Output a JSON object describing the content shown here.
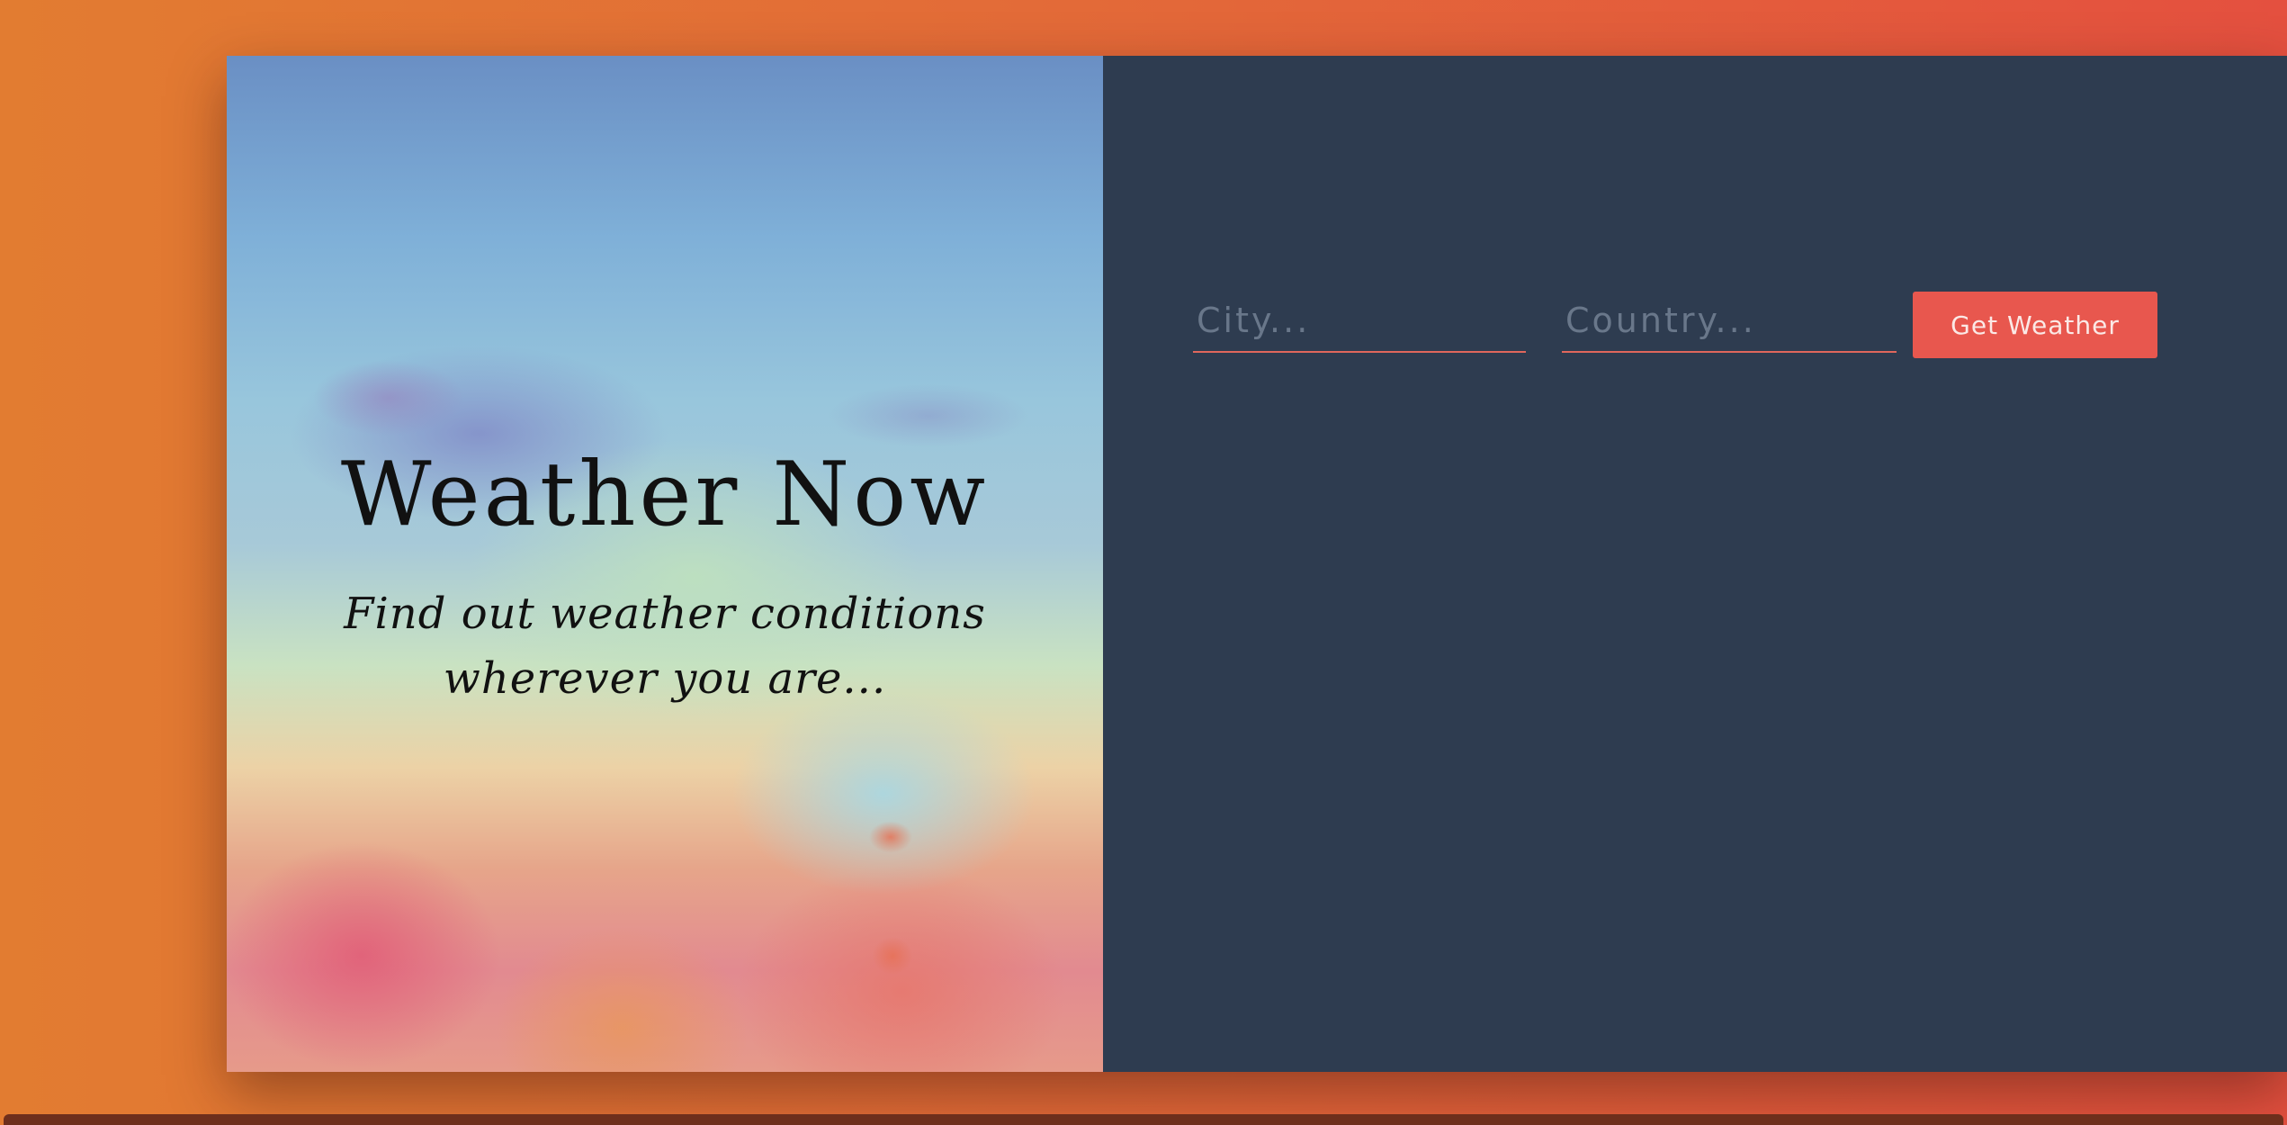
{
  "hero": {
    "title": "Weather Now",
    "subtitle": "Find out weather conditions wherever you are..."
  },
  "form": {
    "city_placeholder": "City...",
    "country_placeholder": "Country...",
    "submit_label": "Get Weather"
  },
  "colors": {
    "background_gradient_start": "#e27c31",
    "background_gradient_end": "#e4503f",
    "panel": "#2e3c50",
    "accent": "#e8574e"
  }
}
